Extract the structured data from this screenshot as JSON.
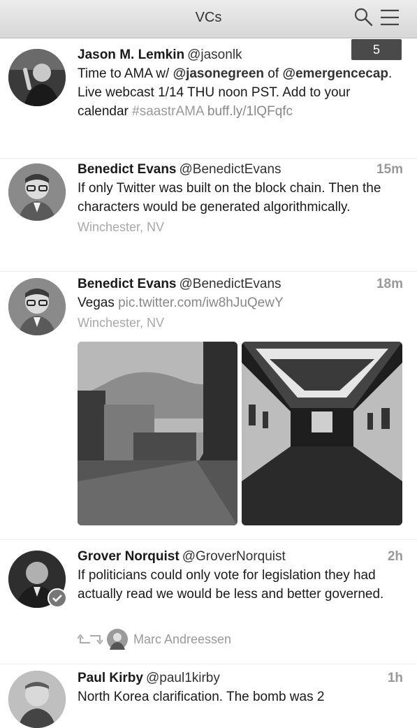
{
  "window": {
    "title": "VCs"
  },
  "badge": {
    "count": "5"
  },
  "tweets": [
    {
      "name": "Jason M. Lemkin",
      "handle": "@jasonlk",
      "time": "",
      "text_parts": [
        "Time to AMA w/ ",
        "@jasonegreen",
        " of ",
        "@emergencecap",
        ". Live webcast 1/14 THU noon PST. Add to your calendar ",
        "#saastrAMA",
        " ",
        "buff.ly/1lQFqfc"
      ]
    },
    {
      "name": "Benedict Evans",
      "handle": "@BenedictEvans",
      "time": "15m",
      "text": "If only Twitter was built on the block chain. Then the characters would be generated algorithmically.",
      "location": "Winchester, NV"
    },
    {
      "name": "Benedict Evans",
      "handle": "@BenedictEvans",
      "time": "18m",
      "text_parts": [
        "Vegas ",
        "pic.twitter.com/iw8hJuQewY"
      ],
      "location": "Winchester, NV"
    },
    {
      "name": "Grover Norquist",
      "handle": "@GroverNorquist",
      "time": "2h",
      "text": "If politicians could only vote for legislation they had actually read we would be less and better governed.",
      "retweeted_by": "Marc Andreessen"
    },
    {
      "name": "Paul Kirby",
      "handle": "@paul1kirby",
      "time": "1h",
      "text": "North Korea clarification. The bomb was 2"
    }
  ],
  "icons": {
    "search": "search-icon",
    "menu": "hamburger-menu-icon",
    "retweet": "retweet-icon",
    "verified": "verified-icon"
  },
  "colors": {
    "text": "#1a1a1a",
    "muted": "#999999",
    "badge": "#4a4a4a"
  }
}
